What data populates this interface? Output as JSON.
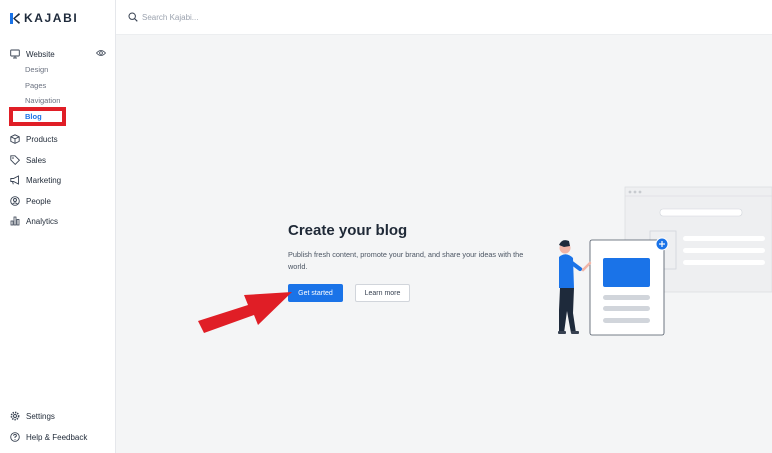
{
  "app": {
    "logo_text": "KAJABI"
  },
  "search": {
    "placeholder": "Search Kajabi..."
  },
  "sidebar": {
    "website_label": "Website",
    "sub_items": [
      "Design",
      "Pages",
      "Navigation",
      "Blog"
    ],
    "active_sub_item": "Blog",
    "items": [
      {
        "label": "Products",
        "icon": "box-icon"
      },
      {
        "label": "Sales",
        "icon": "tag-icon"
      },
      {
        "label": "Marketing",
        "icon": "megaphone-icon"
      },
      {
        "label": "People",
        "icon": "user-circle-icon"
      },
      {
        "label": "Analytics",
        "icon": "bar-chart-icon"
      }
    ],
    "footer": [
      {
        "label": "Settings",
        "icon": "gear-icon"
      },
      {
        "label": "Help & Feedback",
        "icon": "help-icon"
      }
    ]
  },
  "main": {
    "title": "Create your blog",
    "description": "Publish fresh content, promote your brand, and share your ideas with the world.",
    "primary_button": "Get started",
    "secondary_button": "Learn more"
  },
  "colors": {
    "accent": "#1a73e8",
    "highlight": "#e01e26",
    "background": "#f4f5f6"
  }
}
